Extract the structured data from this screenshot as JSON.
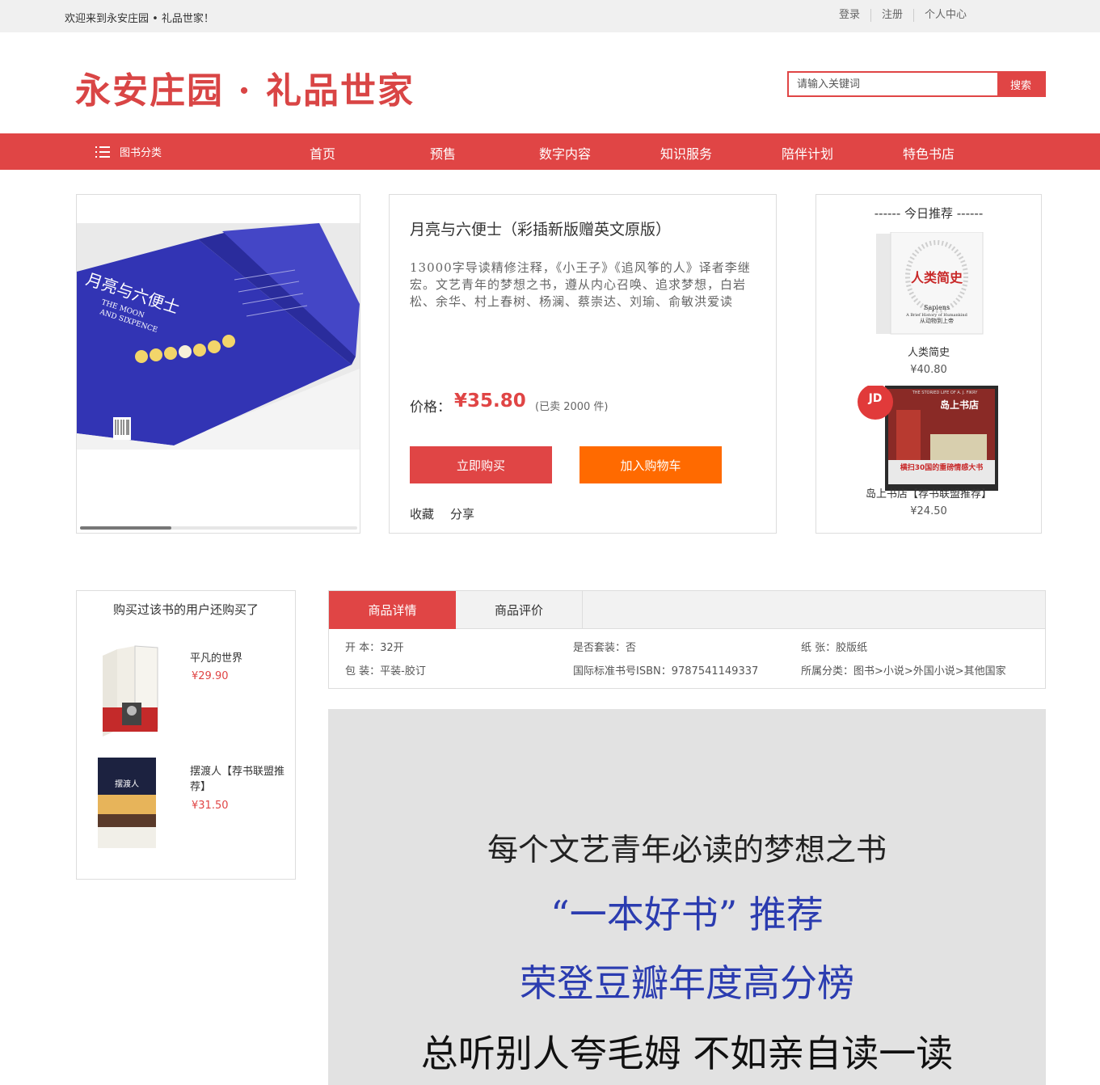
{
  "topbar": {
    "welcome": "欢迎来到永安庄园 • 礼品世家！",
    "links": [
      "登录",
      "注册",
      "个人中心"
    ]
  },
  "header": {
    "logo": "永安庄园 · 礼品世家",
    "search_placeholder": "请输入关键词",
    "search_button": "搜索"
  },
  "nav": {
    "category": "图书分类",
    "items": [
      "首页",
      "预售",
      "数字内容",
      "知识服务",
      "陪伴计划",
      "特色书店"
    ]
  },
  "product": {
    "cover": {
      "title_cn": "月亮与六便士",
      "title_en_1": "THE MOON",
      "title_en_2": "AND SIXPENCE"
    },
    "title": "月亮与六便士（彩插新版赠英文原版）",
    "description": "13000字导读精修注释，《小王子》《追风筝的人》译者李继宏。文艺青年的梦想之书，遵从内心召唤、追求梦想，白岩松、余华、村上春树、杨澜、蔡崇达、刘瑜、俞敏洪爱读",
    "price_label": "价格：",
    "price": "¥35.80",
    "sold": "(已卖 2000 件)",
    "buy_button": "立即购买",
    "cart_button": "加入购物车",
    "favorite": "收藏",
    "share": "分享",
    "gallery_scroll_fraction": 0.33
  },
  "recommend": {
    "title": "------ 今日推荐 ------",
    "items": [
      {
        "name": "人类简史",
        "price": "¥40.80",
        "cover_title": "人类简史",
        "cover_sub": "Sapiens",
        "cover_sub2": "A Brief History of Humankind",
        "cover_sub3": "从动物到上帝"
      },
      {
        "name": "岛上书店【荐书联盟推荐】",
        "price": "¥24.50",
        "cover_title": "岛上书店",
        "cover_en": "THE STORIED LIFE OF A. J. FIKRY",
        "cover_band": "横扫30国的重磅情感大书",
        "badge": "JD"
      }
    ]
  },
  "also_bought": {
    "title": "购买过该书的用户还购买了",
    "items": [
      {
        "name": "平凡的世界",
        "price": "¥29.90"
      },
      {
        "name": "摆渡人【荐书联盟推荐】",
        "price": "¥31.50",
        "cover_title": "摆渡人"
      }
    ]
  },
  "detail": {
    "tabs": [
      "商品详情",
      "商品评价"
    ],
    "attrs": [
      "开 本：32开",
      "是否套装：否",
      "纸 张：胶版纸",
      "包 装：平装-胶订",
      "国际标准书号ISBN：9787541149337",
      "所属分类：图书>小说>外国小说>其他国家"
    ]
  },
  "banner": {
    "line1": "每个文艺青年必读的梦想之书",
    "line2": "“一本好书”   推荐",
    "line3": "荣登豆瓣年度高分榜",
    "line4": "总听别人夸毛姆  不如亲自读一读"
  },
  "colors": {
    "brand_red": "#e04545",
    "orange": "#ff6a00",
    "banner_blue": "#2b3cb0"
  }
}
